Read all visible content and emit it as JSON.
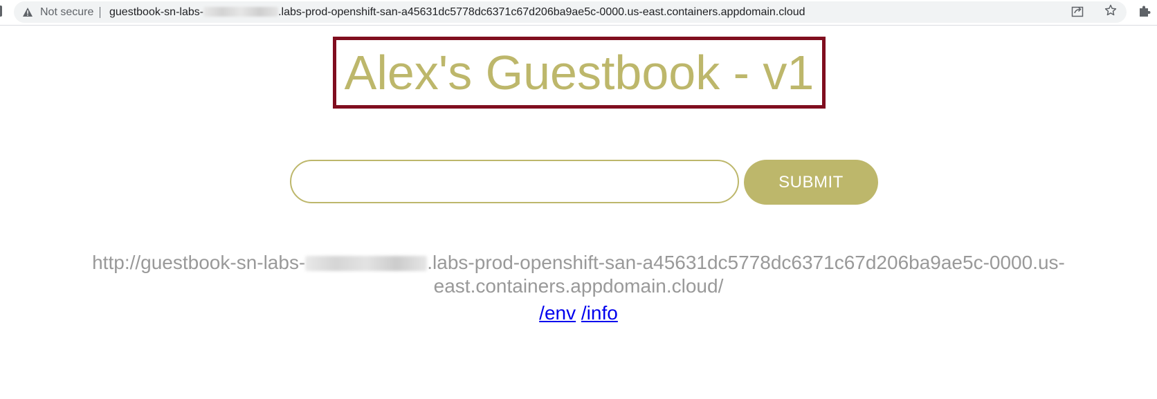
{
  "browser": {
    "security_label": "Not secure",
    "url_prefix": "guestbook-sn-labs-",
    "url_suffix": ".labs-prod-openshift-san-a45631dc5778dc6371c67d206ba9ae5c-0000.us-east.containers.appdomain.cloud",
    "icons": [
      "warning-icon",
      "share-icon",
      "star-icon",
      "extensions-icon"
    ]
  },
  "page": {
    "title": "Alex's Guestbook - v1",
    "input_value": "",
    "submit_label": "SUBMIT",
    "host_prefix": "http://guestbook-sn-labs-",
    "host_suffix_line1": ".labs-prod-openshift-san-a45631dc5778dc6371c67d206ba9ae5c-0000.us-",
    "host_line2": "east.containers.appdomain.cloud/",
    "links": [
      {
        "label": "/env"
      },
      {
        "label": "/info"
      }
    ]
  },
  "colors": {
    "accent": "#bdb76b",
    "title_border": "#800e1f",
    "host_text": "#999999",
    "link": "#0000ee"
  }
}
